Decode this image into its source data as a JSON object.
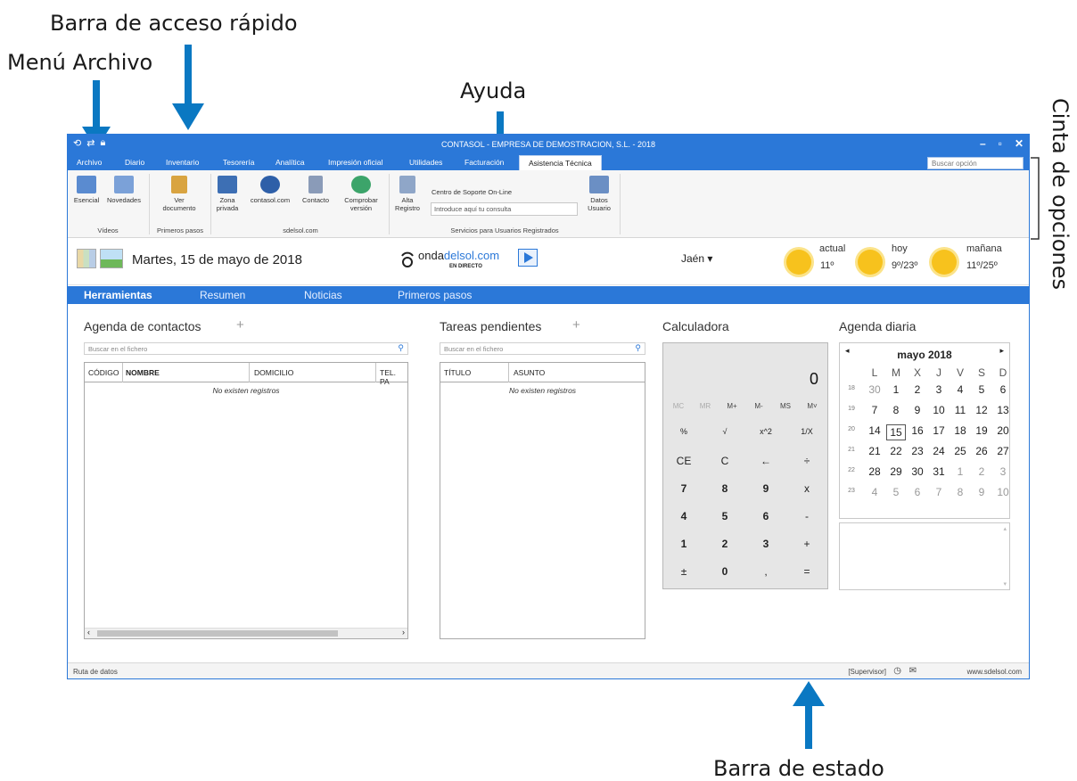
{
  "annotations": {
    "qat": "Barra de acceso rápido",
    "file_menu": "Menú Archivo",
    "help": "Ayuda",
    "ribbon": "Cinta de opciones",
    "statusbar": "Barra de estado"
  },
  "window": {
    "title": "CONTASOL - EMPRESA DE DEMOSTRACION, S.L. - 2018",
    "controls": {
      "minimize": "–",
      "maximize": "▫",
      "close": "✕"
    }
  },
  "menu": {
    "tabs": [
      "Archivo",
      "Diario",
      "Inventario",
      "Tesorería",
      "Analítica",
      "Impresión oficial",
      "Utilidades",
      "Facturación",
      "Asistencia Técnica"
    ],
    "search_placeholder": "Buscar opción"
  },
  "ribbon": {
    "buttons": {
      "esencial": "Esencial",
      "novedades": "Novedades",
      "ver_doc_1": "Ver",
      "ver_doc_2": "documento",
      "zona_1": "Zona",
      "zona_2": "privada",
      "contasol_com": "contasol.com",
      "contacto": "Contacto",
      "comprobar_1": "Comprobar",
      "comprobar_2": "versión",
      "alta_1": "Alta",
      "alta_2": "Registro",
      "datos_1": "Datos",
      "datos_2": "Usuario"
    },
    "groups": {
      "videos": "Vídeos",
      "primeros": "Primeros pasos",
      "sdelsol": "sdelsol.com",
      "servicios": "Servicios para Usuarios Registrados"
    },
    "support_label": "Centro de Soporte On-Line",
    "support_placeholder": "Introduce aquí tu consulta"
  },
  "infobar": {
    "date": "Martes, 15 de mayo de 2018",
    "radio_a": "onda",
    "radio_b": "delsol",
    "radio_c": ".com",
    "radio_sub": "EN DIRECTO",
    "city": "Jaén ▾",
    "weather": [
      {
        "label": "actual",
        "value": "11º"
      },
      {
        "label": "hoy",
        "value": "9º/23º"
      },
      {
        "label": "mañana",
        "value": "11º/25º"
      }
    ]
  },
  "nav": [
    "Herramientas",
    "Resumen",
    "Noticias",
    "Primeros pasos"
  ],
  "contacts": {
    "title": "Agenda de contactos",
    "search": "Buscar en el fichero",
    "columns": [
      "CÓDIGO",
      "NOMBRE",
      "DOMICILIO",
      "TEL. PA"
    ],
    "empty": "No existen registros"
  },
  "tasks": {
    "title": "Tareas pendientes",
    "search": "Buscar en el fichero",
    "columns": [
      "TÍTULO",
      "ASUNTO"
    ],
    "empty": "No existen registros"
  },
  "calculator": {
    "title": "Calculadora",
    "display": "0",
    "memory": [
      "MC",
      "MR",
      "M+",
      "M-",
      "MS",
      "M˅"
    ],
    "rows": [
      [
        "%",
        "√",
        "x^2",
        "1/X"
      ],
      [
        "CE",
        "C",
        "←",
        "÷"
      ],
      [
        "7",
        "8",
        "9",
        "x"
      ],
      [
        "4",
        "5",
        "6",
        "-"
      ],
      [
        "1",
        "2",
        "3",
        "+"
      ],
      [
        "±",
        "0",
        ",",
        "="
      ]
    ]
  },
  "calendar": {
    "title": "Agenda diaria",
    "month": "mayo 2018",
    "days": [
      "L",
      "M",
      "X",
      "J",
      "V",
      "S",
      "D"
    ],
    "weeks": [
      {
        "num": "18",
        "dates": [
          "30",
          "1",
          "2",
          "3",
          "4",
          "5",
          "6"
        ]
      },
      {
        "num": "19",
        "dates": [
          "7",
          "8",
          "9",
          "10",
          "11",
          "12",
          "13"
        ]
      },
      {
        "num": "20",
        "dates": [
          "14",
          "15",
          "16",
          "17",
          "18",
          "19",
          "20"
        ]
      },
      {
        "num": "21",
        "dates": [
          "21",
          "22",
          "23",
          "24",
          "25",
          "26",
          "27"
        ]
      },
      {
        "num": "22",
        "dates": [
          "28",
          "29",
          "30",
          "31",
          "1",
          "2",
          "3"
        ]
      },
      {
        "num": "23",
        "dates": [
          "4",
          "5",
          "6",
          "7",
          "8",
          "9",
          "10"
        ]
      }
    ],
    "selected": "15"
  },
  "status": {
    "left": "Ruta de datos",
    "user": "[Supervisor]",
    "url": "www.sdelsol.com"
  },
  "colors": {
    "accent": "#2b78d8",
    "annotation_arrow": "#0a78c2",
    "sun": "#f7c21d"
  }
}
